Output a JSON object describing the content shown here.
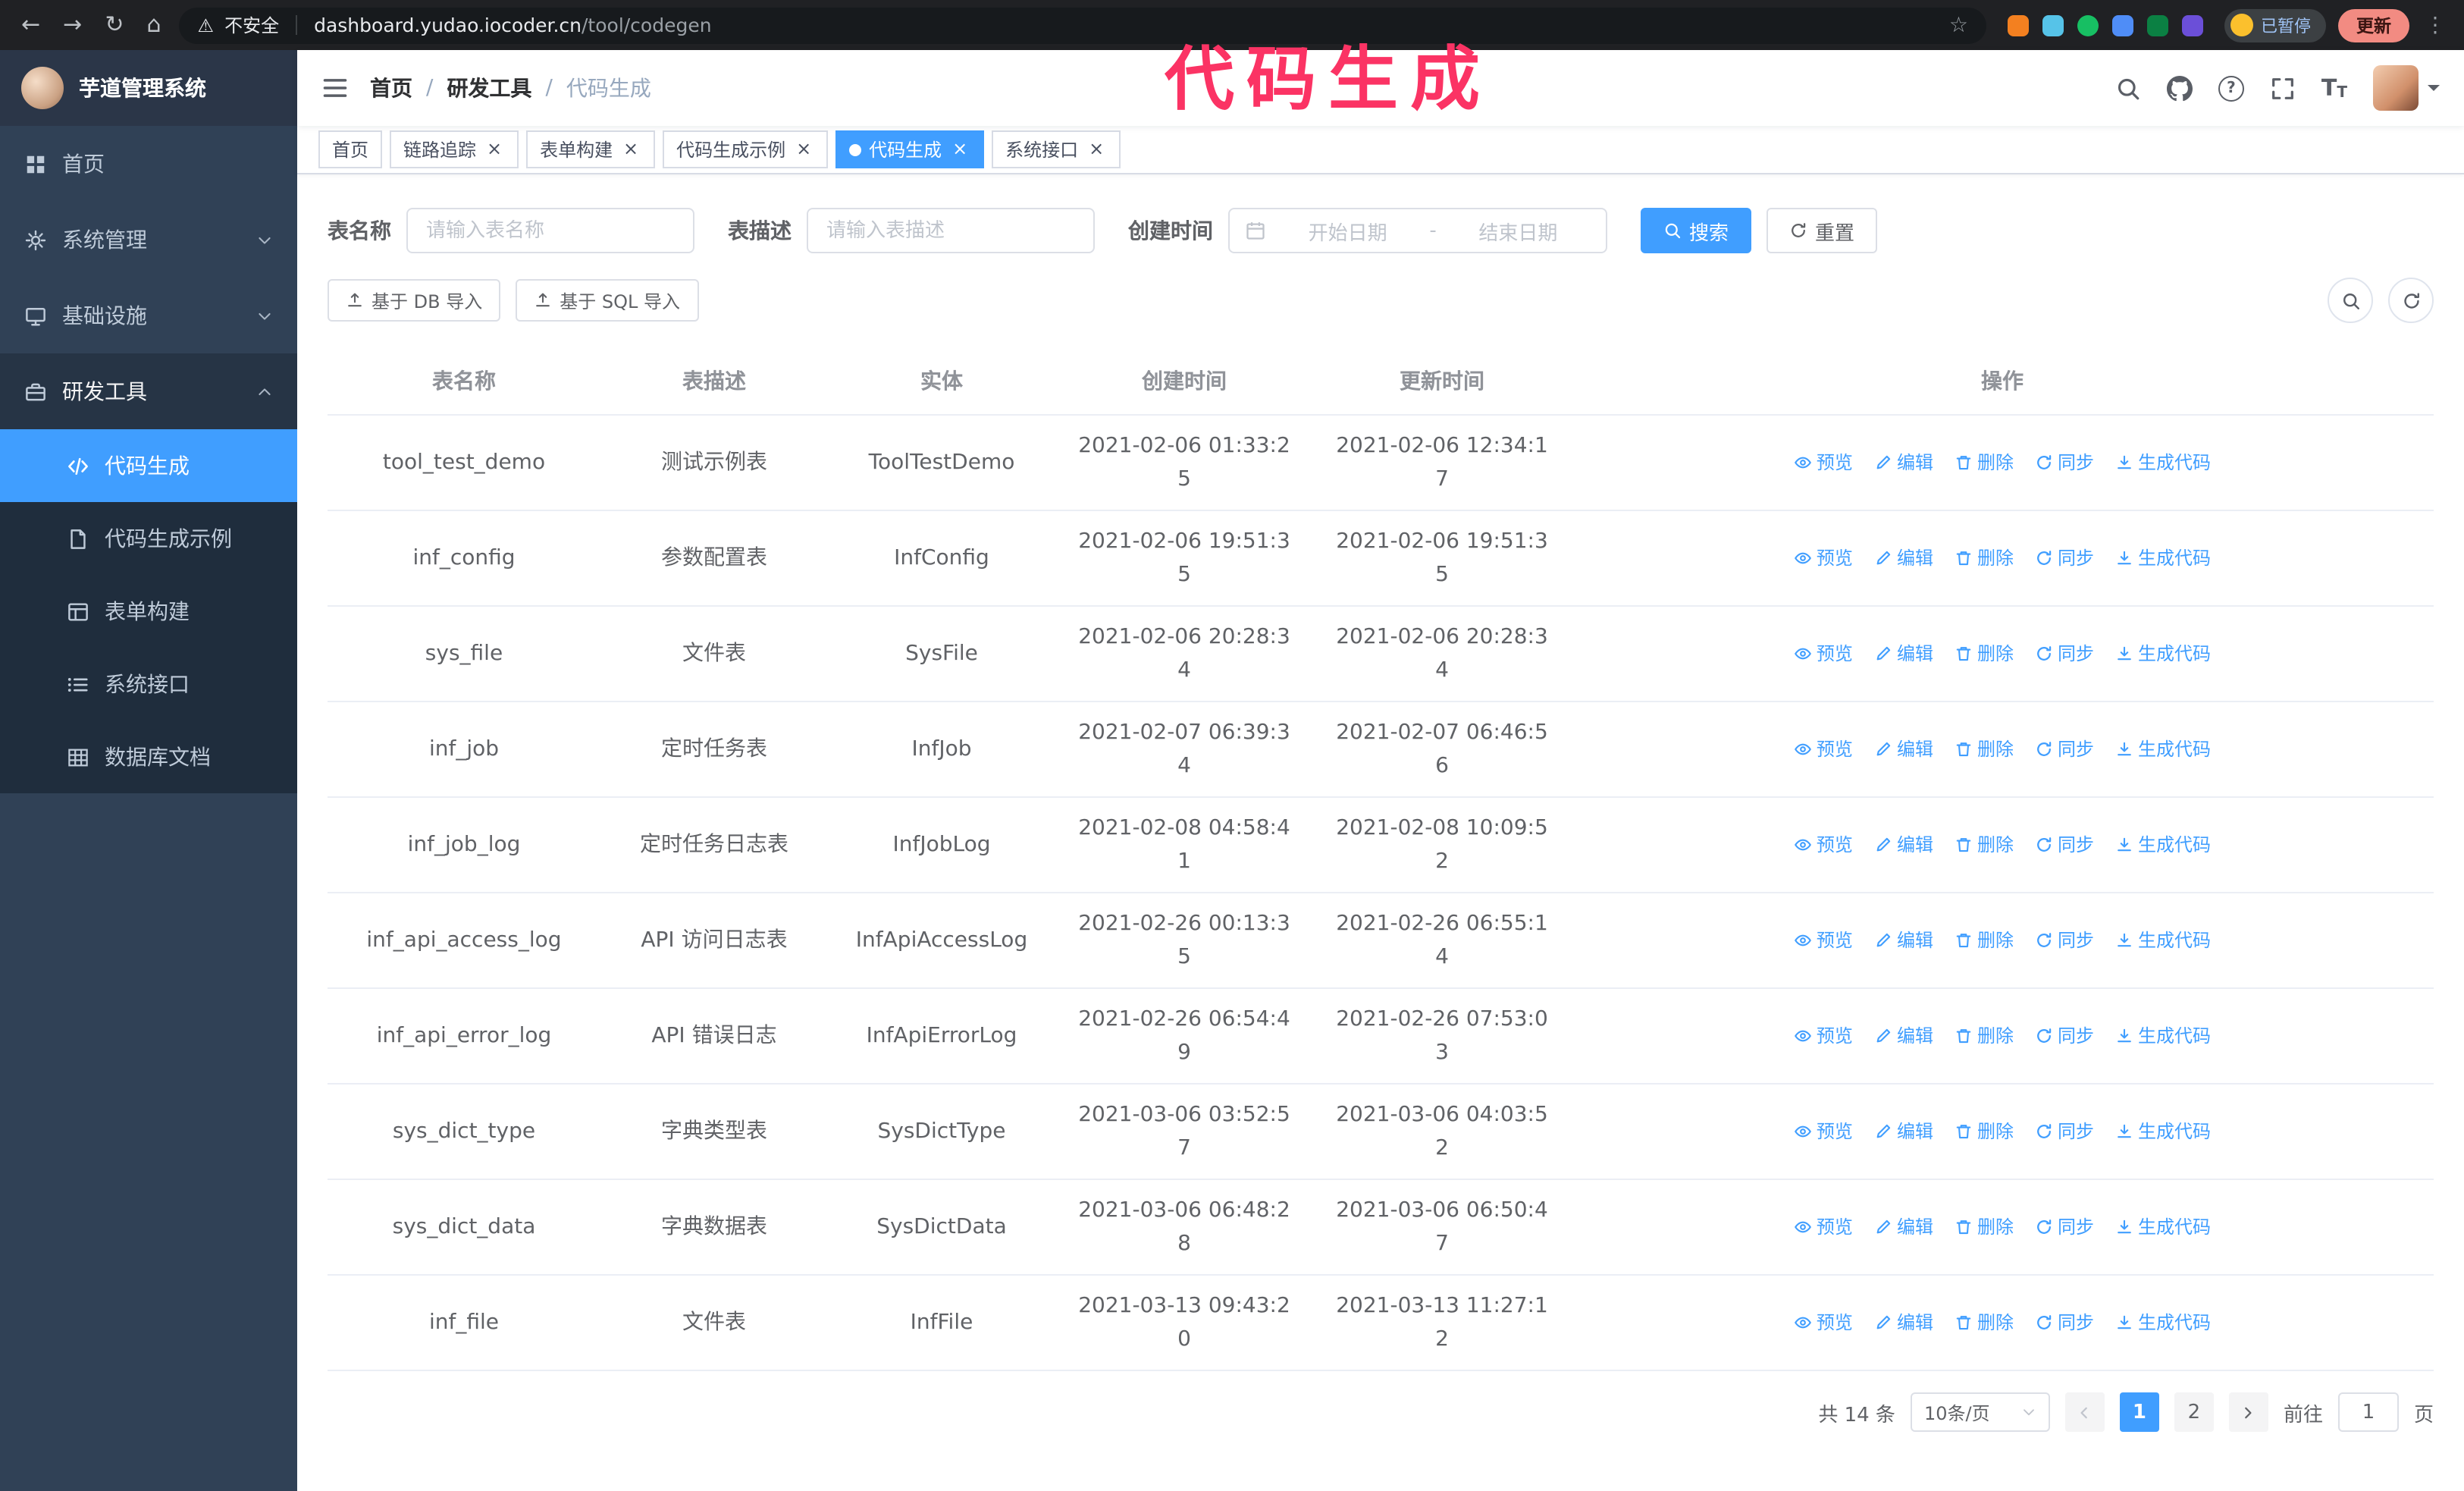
{
  "browser": {
    "security_label": "不安全",
    "url_host": "dashboard.yudao.iocoder.cn",
    "url_path": "/tool/codegen",
    "paused_badge": "已暂停",
    "update_button": "更新"
  },
  "icons": {
    "back": "←",
    "forward": "→",
    "reload": "↻",
    "home": "⌂",
    "star": "☆",
    "warning": "⚠",
    "menu_dots": "⋮",
    "close": "×",
    "question": "?",
    "font_large": "T",
    "font_small": "T"
  },
  "annotation": {
    "text": "代码生成"
  },
  "sidebar": {
    "logo_title": "芋道管理系统",
    "items": [
      {
        "label": "首页",
        "icon": "dashboard-icon"
      },
      {
        "label": "系统管理",
        "icon": "gear-icon",
        "chevron": "down"
      },
      {
        "label": "基础设施",
        "icon": "monitor-icon",
        "chevron": "down"
      },
      {
        "label": "研发工具",
        "icon": "toolbox-icon",
        "chevron": "up",
        "expanded": true,
        "children": [
          {
            "label": "代码生成",
            "icon": "code-icon",
            "active": true
          },
          {
            "label": "代码生成示例",
            "icon": "document-icon"
          },
          {
            "label": "表单构建",
            "icon": "form-icon"
          },
          {
            "label": "系统接口",
            "icon": "list-icon"
          },
          {
            "label": "数据库文档",
            "icon": "table-grid-icon"
          }
        ]
      }
    ]
  },
  "header": {
    "breadcrumb": [
      "首页",
      "研发工具",
      "代码生成"
    ],
    "breadcrumb_separator": "/"
  },
  "tabs": [
    {
      "label": "首页",
      "closable": false,
      "active": false
    },
    {
      "label": "链路追踪",
      "closable": true,
      "active": false
    },
    {
      "label": "表单构建",
      "closable": true,
      "active": false
    },
    {
      "label": "代码生成示例",
      "closable": true,
      "active": false
    },
    {
      "label": "代码生成",
      "closable": true,
      "active": true
    },
    {
      "label": "系统接口",
      "closable": true,
      "active": false
    }
  ],
  "filters": {
    "table_name_label": "表名称",
    "table_name_placeholder": "请输入表名称",
    "table_desc_label": "表描述",
    "table_desc_placeholder": "请输入表描述",
    "create_time_label": "创建时间",
    "date_start_placeholder": "开始日期",
    "date_separator": "-",
    "date_end_placeholder": "结束日期",
    "search_button": "搜索",
    "reset_button": "重置"
  },
  "toolbar": {
    "import_db": "基于 DB 导入",
    "import_sql": "基于 SQL 导入"
  },
  "table": {
    "columns": [
      "表名称",
      "表描述",
      "实体",
      "创建时间",
      "更新时间",
      "操作"
    ],
    "actions": [
      "预览",
      "编辑",
      "删除",
      "同步",
      "生成代码"
    ],
    "rows": [
      {
        "name": "tool_test_demo",
        "desc": "测试示例表",
        "entity": "ToolTestDemo",
        "created": "2021-02-06 01:33:25",
        "updated": "2021-02-06 12:34:17"
      },
      {
        "name": "inf_config",
        "desc": "参数配置表",
        "entity": "InfConfig",
        "created": "2021-02-06 19:51:35",
        "updated": "2021-02-06 19:51:35"
      },
      {
        "name": "sys_file",
        "desc": "文件表",
        "entity": "SysFile",
        "created": "2021-02-06 20:28:34",
        "updated": "2021-02-06 20:28:34"
      },
      {
        "name": "inf_job",
        "desc": "定时任务表",
        "entity": "InfJob",
        "created": "2021-02-07 06:39:34",
        "updated": "2021-02-07 06:46:56"
      },
      {
        "name": "inf_job_log",
        "desc": "定时任务日志表",
        "entity": "InfJobLog",
        "created": "2021-02-08 04:58:41",
        "updated": "2021-02-08 10:09:52"
      },
      {
        "name": "inf_api_access_log",
        "desc": "API 访问日志表",
        "entity": "InfApiAccessLog",
        "created": "2021-02-26 00:13:35",
        "updated": "2021-02-26 06:55:14"
      },
      {
        "name": "inf_api_error_log",
        "desc": "API 错误日志",
        "entity": "InfApiErrorLog",
        "created": "2021-02-26 06:54:49",
        "updated": "2021-02-26 07:53:03"
      },
      {
        "name": "sys_dict_type",
        "desc": "字典类型表",
        "entity": "SysDictType",
        "created": "2021-03-06 03:52:57",
        "updated": "2021-03-06 04:03:52"
      },
      {
        "name": "sys_dict_data",
        "desc": "字典数据表",
        "entity": "SysDictData",
        "created": "2021-03-06 06:48:28",
        "updated": "2021-03-06 06:50:47"
      },
      {
        "name": "inf_file",
        "desc": "文件表",
        "entity": "InfFile",
        "created": "2021-03-13 09:43:20",
        "updated": "2021-03-13 11:27:12"
      }
    ]
  },
  "pagination": {
    "total_text": "共 14 条",
    "page_size": "10条/页",
    "pages": [
      "1",
      "2"
    ],
    "active_page": "1",
    "goto_label": "前往",
    "goto_value": "1",
    "goto_suffix": "页"
  },
  "colors": {
    "accent": "#409eff",
    "sidebar_bg": "#304156",
    "sidebar_submenu_bg": "#1f2d3d",
    "tab_active_bg": "#409eff",
    "annotation": "#fb3364",
    "browser_bar_bg": "#202124"
  }
}
